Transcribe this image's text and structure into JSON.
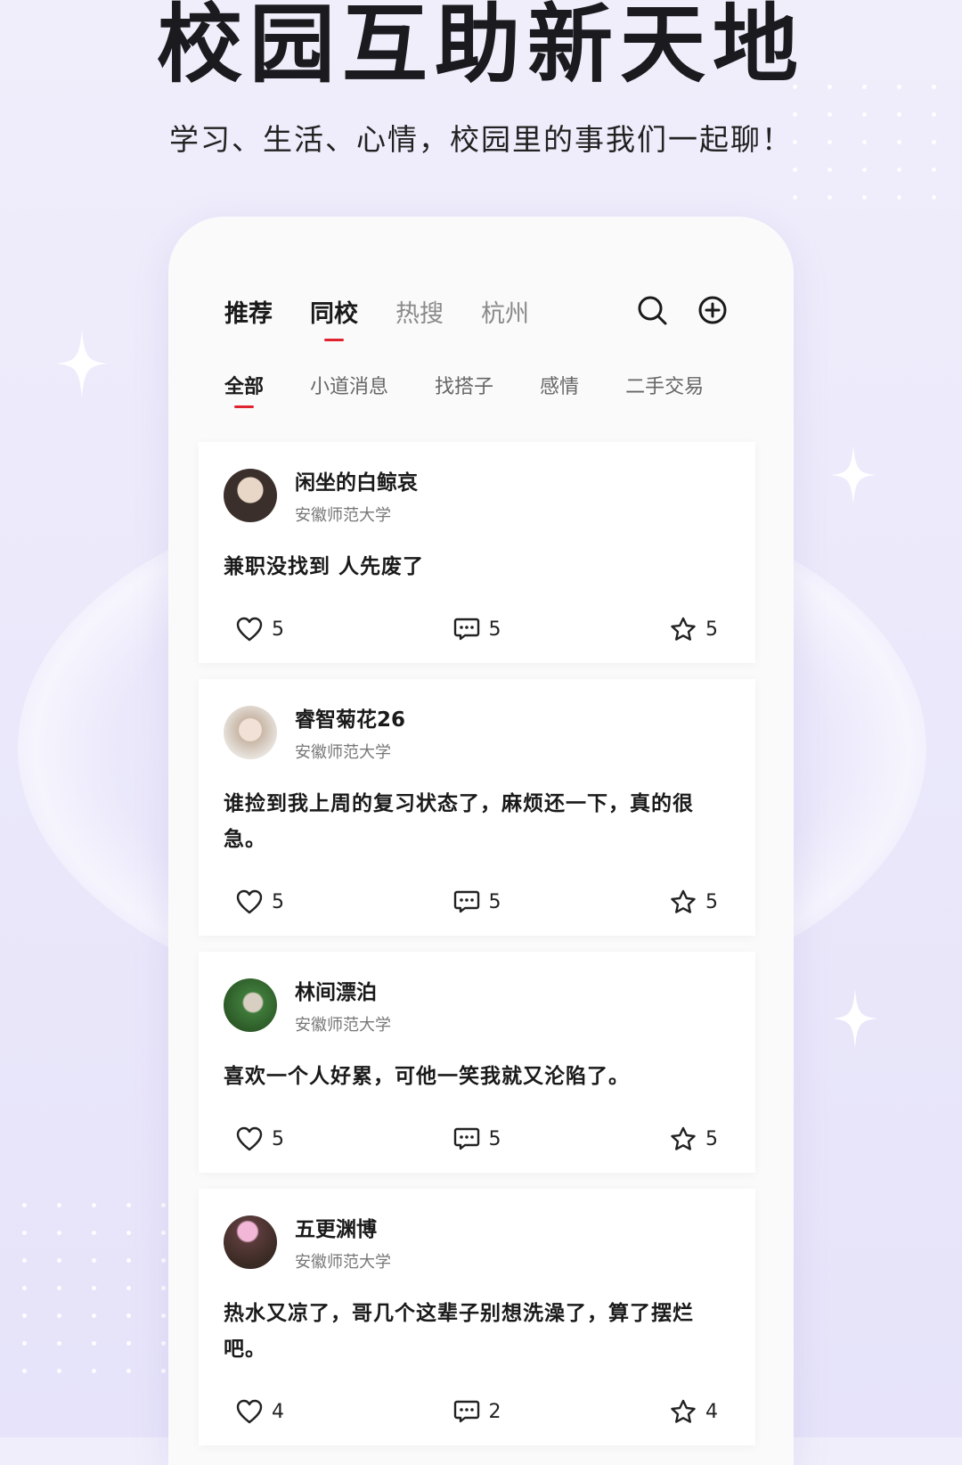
{
  "hero": {
    "title": "校园互助新天地",
    "subtitle": "学习、生活、心情，校园里的事我们一起聊！"
  },
  "nav": {
    "tabs": [
      {
        "label": "推荐"
      },
      {
        "label": "同校"
      },
      {
        "label": "热搜"
      },
      {
        "label": "杭州"
      }
    ],
    "active_tab": "同校",
    "search_icon": "search-icon",
    "add_icon": "plus-circle-icon"
  },
  "categories": {
    "items": [
      {
        "label": "全部"
      },
      {
        "label": "小道消息"
      },
      {
        "label": "找搭子"
      },
      {
        "label": "感情"
      },
      {
        "label": "二手交易"
      }
    ],
    "active": "全部"
  },
  "posts": [
    {
      "user": "闲坐的白鲸哀",
      "school": "安徽师范大学",
      "content": "兼职没找到 人先废了",
      "likes": "5",
      "comments": "5",
      "favorites": "5",
      "avatar_color": "#3a2f2a"
    },
    {
      "user": "睿智菊花26",
      "school": "安徽师范大学",
      "content": "谁捡到我上周的复习状态了，麻烦还一下，真的很急。",
      "likes": "5",
      "comments": "5",
      "favorites": "5",
      "avatar_color": "#c9b8a8"
    },
    {
      "user": "林间漂泊",
      "school": "安徽师范大学",
      "content": "喜欢一个人好累，可他一笑我就又沦陷了。",
      "likes": "5",
      "comments": "5",
      "favorites": "5",
      "avatar_color": "#3f7a3a"
    },
    {
      "user": "五更渊博",
      "school": "安徽师范大学",
      "content": "热水又凉了，哥几个这辈子别想洗澡了，算了摆烂吧。",
      "likes": "4",
      "comments": "2",
      "favorites": "4",
      "avatar_color": "#5a3b3b"
    }
  ],
  "colors": {
    "accent": "#e0242f",
    "background": "#ece9fb"
  }
}
